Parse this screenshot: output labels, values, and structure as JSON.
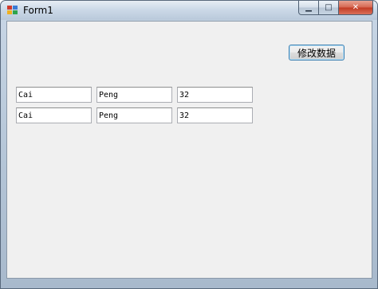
{
  "window": {
    "title": "Form1",
    "icon": "winforms-app-icon",
    "controls": {
      "minimize_icon": "minimize-icon",
      "maximize_icon": "maximize-icon",
      "close_icon": "close-icon",
      "minimize_glyph": "▁",
      "maximize_glyph": "□",
      "close_glyph": "✕"
    }
  },
  "form": {
    "modify_button_label": "修改数据",
    "rows": [
      {
        "first": "Cai",
        "last": "Peng",
        "age": "32"
      },
      {
        "first": "Cai",
        "last": "Peng",
        "age": "32"
      }
    ]
  },
  "colors": {
    "client_bg": "#f0f0f0",
    "button_focus_border": "#3c7fb1",
    "close_button": "#c23a22"
  }
}
